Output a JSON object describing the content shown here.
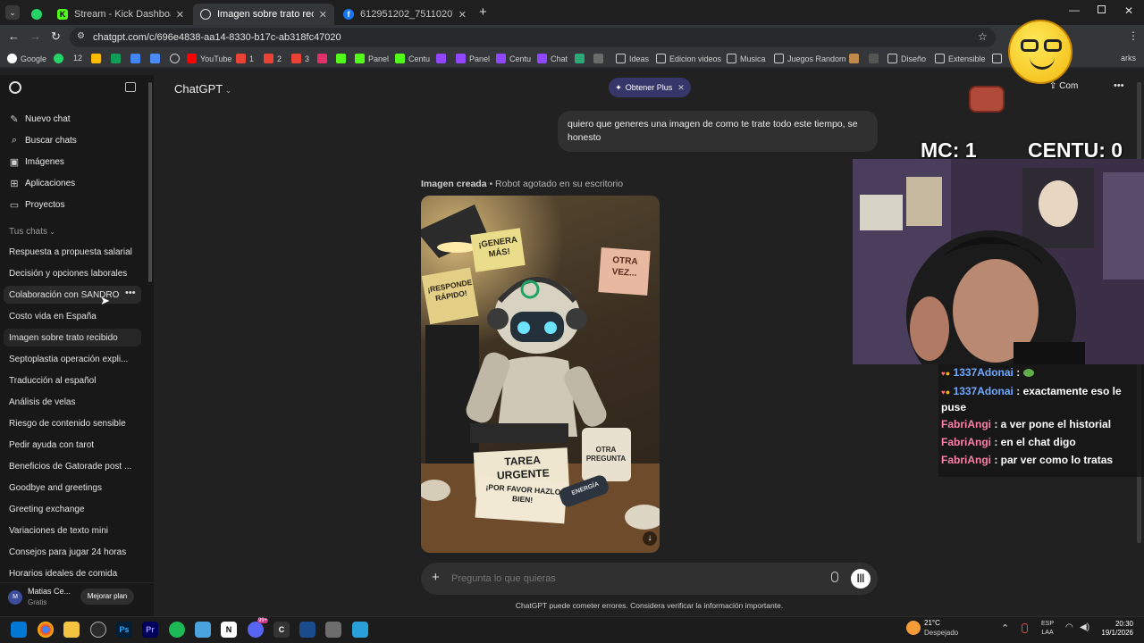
{
  "browser": {
    "tabs": [
      {
        "title": "Stream - Kick Dashboard",
        "color": "#53fc18"
      },
      {
        "title": "Imagen sobre trato recibido",
        "color": "#ffffff"
      },
      {
        "title": "612951202_7511020747159966",
        "color": "#1877f2"
      }
    ],
    "url": "chatgpt.com/c/696e4838-aa14-8330-b17c-ab318fc47020",
    "bookmarks": [
      "Google",
      "12",
      "YouTube",
      "1",
      "2",
      "3",
      "Panel",
      "Centu",
      "Panel",
      "Centu",
      "Chat",
      "Ideas",
      "Edicion videos",
      "Musica",
      "Juegos Random",
      "Diseño",
      "Extensible"
    ],
    "bookmarks_overflow": "arks"
  },
  "sidebar": {
    "nav": [
      {
        "label": "Nuevo chat",
        "icon": "new-chat-icon"
      },
      {
        "label": "Buscar chats",
        "icon": "search-icon"
      },
      {
        "label": "Imágenes",
        "icon": "images-icon"
      },
      {
        "label": "Aplicaciones",
        "icon": "apps-icon"
      },
      {
        "label": "Proyectos",
        "icon": "folder-icon"
      }
    ],
    "section_label": "Tus chats",
    "chats": [
      "Respuesta a propuesta salarial",
      "Decisión y opciones laborales",
      "Colaboración con SANDRO",
      "Costo vida en España",
      "Imagen sobre trato recibido",
      "Septoplastia operación expli...",
      "Traducción al español",
      "Análisis de velas",
      "Riesgo de contenido sensible",
      "Pedir ayuda con tarot",
      "Beneficios de Gatorade post ...",
      "Goodbye and greetings",
      "Greeting exchange",
      "Variaciones de texto mini",
      "Consejos para jugar 24 horas",
      "Horarios ideales de comida"
    ],
    "user": {
      "initials": "M",
      "name": "Matias Ce...",
      "plan": "Gratis",
      "upgrade": "Mejorar plan"
    }
  },
  "main": {
    "model": "ChatGPT",
    "plus_label": "Obtener Plus",
    "share_label": "Com",
    "user_message": "quiero que generes una imagen de como te trate todo este tiempo, se honesto",
    "image_caption_bold": "Imagen creada",
    "image_caption": "• Robot agotado en su escritorio",
    "image_texts": {
      "note1": "¡GENERA MÁS!",
      "note2": "OTRA VEZ...",
      "note3": "¡RESPONDE RÁPIDO!",
      "paper1": "TAREA URGENTE",
      "paper2": "¡POR FAVOR HAZLO BIEN!",
      "mug": "OTRA PREGUNTA",
      "can": "ENERGÍA"
    },
    "composer_placeholder": "Pregunta lo que quieras",
    "disclaimer": "ChatGPT puede cometer errores. Considera verificar la información importante."
  },
  "overlay": {
    "score_left": "MC: 1",
    "score_right": "CENTU: 0",
    "chat": [
      {
        "user": "1337Adonai",
        "user_color": "#6ea8ff",
        "text": ":"
      },
      {
        "user": "1337Adonai",
        "user_color": "#6ea8ff",
        "text": ": exactamente eso le puse"
      },
      {
        "user": "FabriAngi",
        "user_color": "#ff7fa8",
        "text": ": a ver pone el historial"
      },
      {
        "user": "FabriAngi",
        "user_color": "#ff7fa8",
        "text": ": en el chat digo"
      },
      {
        "user": "FabriAngi",
        "user_color": "#ff7fa8",
        "text": ": par ver como lo tratas"
      }
    ]
  },
  "taskbar": {
    "weather_temp": "21°C",
    "weather_desc": "Despejado",
    "lang1": "ESP",
    "lang2": "LAA",
    "time": "20:30",
    "date": "19/1/2026",
    "badge": "99+"
  }
}
